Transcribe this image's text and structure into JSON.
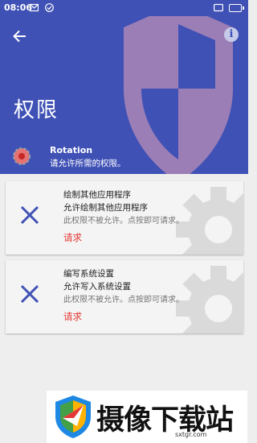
{
  "status_bar": {
    "time": "08:06"
  },
  "header": {
    "title": "权限",
    "app_name": "Rotation",
    "app_description": "请允许所需的权限。",
    "info_glyph": "i",
    "accent_color": "#3f51b5"
  },
  "permissions": [
    {
      "title": "绘制其他应用程序",
      "subtitle": "允许绘制其他应用程序",
      "status": "此权限不被允许。点按即可请求。",
      "action": "请求"
    },
    {
      "title": "编写系统设置",
      "subtitle": "允许写入系统设置",
      "status": "此权限不被允许。点按即可请求。",
      "action": "请求"
    }
  ],
  "watermark": {
    "brand": "摄像下载站",
    "url": "sxtgr.com"
  },
  "icons": [
    "arrow-back-icon",
    "info-icon",
    "shield-icon",
    "gear-icon",
    "close-icon",
    "app-icon",
    "logo-icon"
  ]
}
